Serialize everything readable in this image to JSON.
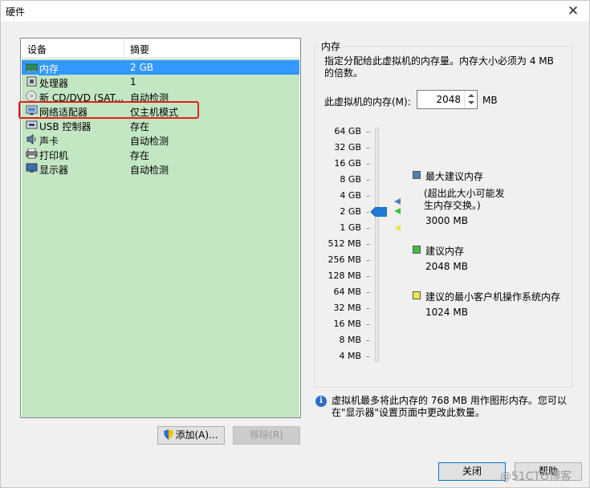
{
  "window": {
    "title": "硬件",
    "close_glyph": "✕"
  },
  "device_list": {
    "headers": {
      "device": "设备",
      "summary": "摘要"
    },
    "rows": [
      {
        "name": "内存",
        "value": "2 GB",
        "icon": "memory-icon",
        "selected": true
      },
      {
        "name": "处理器",
        "value": "1",
        "icon": "processor-icon"
      },
      {
        "name": "新 CD/DVD (SAT...",
        "value": "自动检测",
        "icon": "cd-dvd-icon"
      },
      {
        "name": "网络适配器",
        "value": "仅主机模式",
        "icon": "network-adapter-icon"
      },
      {
        "name": "USB 控制器",
        "value": "存在",
        "icon": "usb-icon"
      },
      {
        "name": "声卡",
        "value": "自动检测",
        "icon": "sound-card-icon"
      },
      {
        "name": "打印机",
        "value": "存在",
        "icon": "printer-icon"
      },
      {
        "name": "显示器",
        "value": "自动检测",
        "icon": "display-icon"
      }
    ]
  },
  "buttons": {
    "add": "添加(A)...",
    "remove": "移除(R)",
    "close": "关闭",
    "help": "帮助"
  },
  "memory_panel": {
    "group_title": "内存",
    "description": "指定分配给此虚拟机的内存量。内存大小必须为 4 MB 的倍数。",
    "memory_label": "此虚拟机的内存(M):",
    "memory_value": "2048",
    "memory_unit": "MB",
    "scale_ticks": [
      "64 GB",
      "32 GB",
      "16 GB",
      "8 GB",
      "4 GB",
      "2 GB",
      "1 GB",
      "512 MB",
      "256 MB",
      "128 MB",
      "64 MB",
      "32 MB",
      "16 MB",
      "8 MB",
      "4 MB"
    ],
    "legend": {
      "max_recommended": {
        "label": "最大建议内存",
        "note": "(超出此大小可能发生内存交换。)",
        "value": "3000 MB",
        "color": "#4a7ebb"
      },
      "recommended": {
        "label": "建议内存",
        "value": "2048 MB",
        "color": "#3fbf3f"
      },
      "min_guest": {
        "label": "建议的最小客户机操作系统内存",
        "value": "1024 MB",
        "color": "#e8e84a"
      }
    },
    "info_text": "虚拟机最多将此内存的 768 MB 用作图形内存。您可以在\"显示器\"设置页面中更改此数量。"
  },
  "watermark": "@51CTO博客"
}
